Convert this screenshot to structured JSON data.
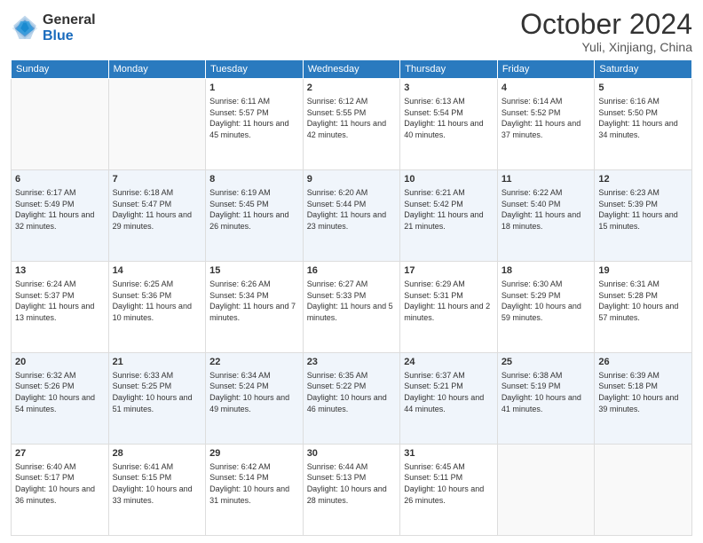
{
  "logo": {
    "general": "General",
    "blue": "Blue"
  },
  "title": "October 2024",
  "location": "Yuli, Xinjiang, China",
  "days_of_week": [
    "Sunday",
    "Monday",
    "Tuesday",
    "Wednesday",
    "Thursday",
    "Friday",
    "Saturday"
  ],
  "weeks": [
    [
      {
        "day": "",
        "empty": true
      },
      {
        "day": "",
        "empty": true
      },
      {
        "day": "1",
        "sunrise": "6:11 AM",
        "sunset": "5:57 PM",
        "daylight": "11 hours and 45 minutes."
      },
      {
        "day": "2",
        "sunrise": "6:12 AM",
        "sunset": "5:55 PM",
        "daylight": "11 hours and 42 minutes."
      },
      {
        "day": "3",
        "sunrise": "6:13 AM",
        "sunset": "5:54 PM",
        "daylight": "11 hours and 40 minutes."
      },
      {
        "day": "4",
        "sunrise": "6:14 AM",
        "sunset": "5:52 PM",
        "daylight": "11 hours and 37 minutes."
      },
      {
        "day": "5",
        "sunrise": "6:16 AM",
        "sunset": "5:50 PM",
        "daylight": "11 hours and 34 minutes."
      }
    ],
    [
      {
        "day": "6",
        "sunrise": "6:17 AM",
        "sunset": "5:49 PM",
        "daylight": "11 hours and 32 minutes."
      },
      {
        "day": "7",
        "sunrise": "6:18 AM",
        "sunset": "5:47 PM",
        "daylight": "11 hours and 29 minutes."
      },
      {
        "day": "8",
        "sunrise": "6:19 AM",
        "sunset": "5:45 PM",
        "daylight": "11 hours and 26 minutes."
      },
      {
        "day": "9",
        "sunrise": "6:20 AM",
        "sunset": "5:44 PM",
        "daylight": "11 hours and 23 minutes."
      },
      {
        "day": "10",
        "sunrise": "6:21 AM",
        "sunset": "5:42 PM",
        "daylight": "11 hours and 21 minutes."
      },
      {
        "day": "11",
        "sunrise": "6:22 AM",
        "sunset": "5:40 PM",
        "daylight": "11 hours and 18 minutes."
      },
      {
        "day": "12",
        "sunrise": "6:23 AM",
        "sunset": "5:39 PM",
        "daylight": "11 hours and 15 minutes."
      }
    ],
    [
      {
        "day": "13",
        "sunrise": "6:24 AM",
        "sunset": "5:37 PM",
        "daylight": "11 hours and 13 minutes."
      },
      {
        "day": "14",
        "sunrise": "6:25 AM",
        "sunset": "5:36 PM",
        "daylight": "11 hours and 10 minutes."
      },
      {
        "day": "15",
        "sunrise": "6:26 AM",
        "sunset": "5:34 PM",
        "daylight": "11 hours and 7 minutes."
      },
      {
        "day": "16",
        "sunrise": "6:27 AM",
        "sunset": "5:33 PM",
        "daylight": "11 hours and 5 minutes."
      },
      {
        "day": "17",
        "sunrise": "6:29 AM",
        "sunset": "5:31 PM",
        "daylight": "11 hours and 2 minutes."
      },
      {
        "day": "18",
        "sunrise": "6:30 AM",
        "sunset": "5:29 PM",
        "daylight": "10 hours and 59 minutes."
      },
      {
        "day": "19",
        "sunrise": "6:31 AM",
        "sunset": "5:28 PM",
        "daylight": "10 hours and 57 minutes."
      }
    ],
    [
      {
        "day": "20",
        "sunrise": "6:32 AM",
        "sunset": "5:26 PM",
        "daylight": "10 hours and 54 minutes."
      },
      {
        "day": "21",
        "sunrise": "6:33 AM",
        "sunset": "5:25 PM",
        "daylight": "10 hours and 51 minutes."
      },
      {
        "day": "22",
        "sunrise": "6:34 AM",
        "sunset": "5:24 PM",
        "daylight": "10 hours and 49 minutes."
      },
      {
        "day": "23",
        "sunrise": "6:35 AM",
        "sunset": "5:22 PM",
        "daylight": "10 hours and 46 minutes."
      },
      {
        "day": "24",
        "sunrise": "6:37 AM",
        "sunset": "5:21 PM",
        "daylight": "10 hours and 44 minutes."
      },
      {
        "day": "25",
        "sunrise": "6:38 AM",
        "sunset": "5:19 PM",
        "daylight": "10 hours and 41 minutes."
      },
      {
        "day": "26",
        "sunrise": "6:39 AM",
        "sunset": "5:18 PM",
        "daylight": "10 hours and 39 minutes."
      }
    ],
    [
      {
        "day": "27",
        "sunrise": "6:40 AM",
        "sunset": "5:17 PM",
        "daylight": "10 hours and 36 minutes."
      },
      {
        "day": "28",
        "sunrise": "6:41 AM",
        "sunset": "5:15 PM",
        "daylight": "10 hours and 33 minutes."
      },
      {
        "day": "29",
        "sunrise": "6:42 AM",
        "sunset": "5:14 PM",
        "daylight": "10 hours and 31 minutes."
      },
      {
        "day": "30",
        "sunrise": "6:44 AM",
        "sunset": "5:13 PM",
        "daylight": "10 hours and 28 minutes."
      },
      {
        "day": "31",
        "sunrise": "6:45 AM",
        "sunset": "5:11 PM",
        "daylight": "10 hours and 26 minutes."
      },
      {
        "day": "",
        "empty": true
      },
      {
        "day": "",
        "empty": true
      }
    ]
  ]
}
